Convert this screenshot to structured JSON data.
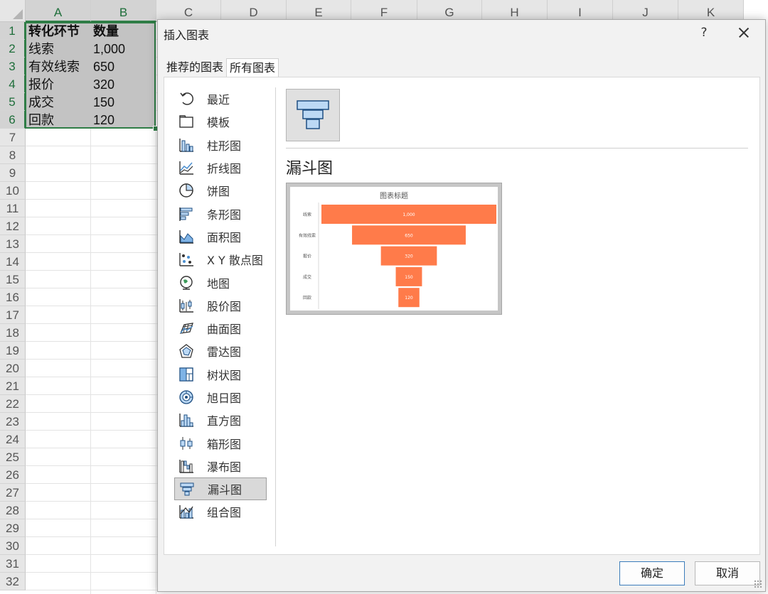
{
  "sheet": {
    "columns": [
      "A",
      "B",
      "C",
      "D",
      "E",
      "F",
      "G",
      "H",
      "I",
      "J",
      "K"
    ],
    "rows": [
      "1",
      "2",
      "3",
      "4",
      "5",
      "6",
      "7",
      "8",
      "9",
      "10",
      "11",
      "12",
      "13",
      "14",
      "15",
      "16",
      "17",
      "18",
      "19",
      "20",
      "21",
      "22",
      "23",
      "24",
      "25",
      "26",
      "27",
      "28",
      "29",
      "30",
      "31",
      "32"
    ],
    "cells": [
      {
        "a": "转化环节",
        "b": "数量"
      },
      {
        "a": "线索",
        "b": "1,000"
      },
      {
        "a": "有效线索",
        "b": "650"
      },
      {
        "a": "报价",
        "b": "320"
      },
      {
        "a": "成交",
        "b": "150"
      },
      {
        "a": "回款",
        "b": "120"
      }
    ]
  },
  "dialog": {
    "title": "插入图表",
    "help": "?",
    "tabs": [
      "推荐的图表",
      "所有图表"
    ],
    "active_tab": 1,
    "chart_types": [
      {
        "label": "最近",
        "icon": "recent-icon"
      },
      {
        "label": "模板",
        "icon": "template-folder-icon"
      },
      {
        "label": "柱形图",
        "icon": "column-chart-icon"
      },
      {
        "label": "折线图",
        "icon": "line-chart-icon"
      },
      {
        "label": "饼图",
        "icon": "pie-chart-icon"
      },
      {
        "label": "条形图",
        "icon": "bar-chart-icon"
      },
      {
        "label": "面积图",
        "icon": "area-chart-icon"
      },
      {
        "label": "X Y 散点图",
        "icon": "scatter-chart-icon"
      },
      {
        "label": "地图",
        "icon": "map-globe-icon"
      },
      {
        "label": "股价图",
        "icon": "stock-chart-icon"
      },
      {
        "label": "曲面图",
        "icon": "surface-chart-icon"
      },
      {
        "label": "雷达图",
        "icon": "radar-chart-icon"
      },
      {
        "label": "树状图",
        "icon": "treemap-chart-icon"
      },
      {
        "label": "旭日图",
        "icon": "sunburst-chart-icon"
      },
      {
        "label": "直方图",
        "icon": "histogram-chart-icon"
      },
      {
        "label": "箱形图",
        "icon": "box-whisker-chart-icon"
      },
      {
        "label": "瀑布图",
        "icon": "waterfall-chart-icon"
      },
      {
        "label": "漏斗图",
        "icon": "funnel-chart-icon"
      },
      {
        "label": "组合图",
        "icon": "combo-chart-icon"
      }
    ],
    "selected_type_index": 17,
    "subtype_title": "漏斗图",
    "ok_label": "确定",
    "cancel_label": "取消"
  },
  "colors": {
    "accent_green": "#2f7d46",
    "funnel_bar": "#ff7b4a",
    "icon_blue": "#4a8fd0",
    "icon_fill": "#bcd9f5"
  },
  "chart_data": {
    "type": "bar",
    "subtype": "funnel",
    "title": "图表标题",
    "categories": [
      "线索",
      "有效线索",
      "报价",
      "成交",
      "回款"
    ],
    "values": [
      1000,
      650,
      320,
      150,
      120
    ],
    "value_labels": [
      "1,000",
      "650",
      "320",
      "150",
      "120"
    ]
  }
}
